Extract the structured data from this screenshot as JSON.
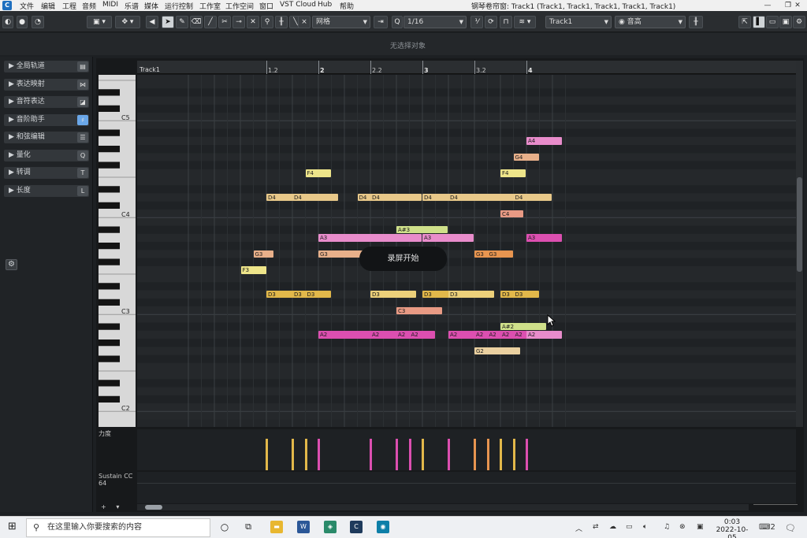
{
  "window": {
    "title": "钢琴卷帘窗: Track1 (Track1, Track1, Track1, Track1, Track1)",
    "buttons": [
      "—",
      "❐",
      "✕"
    ]
  },
  "menu": [
    "文件",
    "编辑",
    "工程",
    "音频",
    "MIDI",
    "乐谱",
    "媒体",
    "运行控制",
    "工作室",
    "工作空间",
    "窗口",
    "VST Cloud",
    "Hub",
    "帮助"
  ],
  "toolbar": {
    "snap_type": "网格",
    "quantize": "1/16",
    "track": "Track1",
    "articulation": "音高"
  },
  "info": {
    "text": "无选择对象"
  },
  "inspector": {
    "sections": [
      {
        "label": "全局轨道",
        "icon": "global-tracks-icon"
      },
      {
        "label": "表达映射",
        "icon": "expression-map-icon"
      },
      {
        "label": "音符表达",
        "icon": "note-expression-icon"
      },
      {
        "label": "音阶助手",
        "icon": "scale-assistant-icon"
      },
      {
        "label": "和弦编辑",
        "icon": "chord-editing-icon"
      },
      {
        "label": "量化",
        "icon": "quantize-icon"
      },
      {
        "label": "转调",
        "icon": "transpose-icon"
      },
      {
        "label": "长度",
        "icon": "length-icon"
      }
    ]
  },
  "ruler": {
    "track_label": "Track1",
    "labels": [
      {
        "t": "1.2",
        "beat": 1,
        "bold": false
      },
      {
        "t": "2",
        "beat": 2,
        "bold": true
      },
      {
        "t": "2.2",
        "beat": 3,
        "bold": false
      },
      {
        "t": "3",
        "beat": 4,
        "bold": true
      },
      {
        "t": "3.2",
        "beat": 5,
        "bold": false
      },
      {
        "t": "4",
        "beat": 6,
        "bold": true
      }
    ]
  },
  "keys": {
    "octave_labels": [
      "C5",
      "C4",
      "C3",
      "C2"
    ]
  },
  "colors": {
    "yellow": "#e2b84a",
    "yellow_light": "#ecd07a",
    "pink": "#dc4fb0",
    "pink_light": "#e88ccb",
    "salmon": "#e89a84",
    "lime": "#cfe08a",
    "orange": "#e89550",
    "cream": "#ead7a0"
  },
  "notes": [
    {
      "p": "F3",
      "s": 1.02,
      "l": 0.5,
      "c": "#eee58a"
    },
    {
      "p": "G3",
      "s": 1.5,
      "l": 0.4,
      "c": "#e8b08a"
    },
    {
      "p": "D4",
      "s": 2.0,
      "l": 1.0,
      "c": "#e8c889"
    },
    {
      "p": "D4",
      "s": 3.0,
      "l": 0.9,
      "c": "#e8c889"
    },
    {
      "p": "D3",
      "s": 2.0,
      "l": 1.0,
      "c": "#e2b84a"
    },
    {
      "p": "D3",
      "s": 3.0,
      "l": 0.5,
      "c": "#e2b84a"
    },
    {
      "p": "D3",
      "s": 3.5,
      "l": 0.5,
      "c": "#e2b84a"
    },
    {
      "p": "F4",
      "s": 3.5,
      "l": 0.5,
      "c": "#eee58a"
    },
    {
      "p": "A3",
      "s": 4.0,
      "l": 2.0,
      "c": "#e88ccb"
    },
    {
      "p": "G3",
      "s": 4.0,
      "l": 1.0,
      "c": "#e8b08a"
    },
    {
      "p": "A2",
      "s": 4.0,
      "l": 2.0,
      "c": "#dc4fb0"
    },
    {
      "p": "D4",
      "s": 5.5,
      "l": 0.5,
      "c": "#e8c889"
    },
    {
      "p": "D4",
      "s": 6.0,
      "l": 1.0,
      "c": "#e8c889"
    },
    {
      "p": "D3",
      "s": 6.0,
      "l": 0.9,
      "c": "#ecd07a"
    },
    {
      "p": "A2",
      "s": 6.0,
      "l": 1.0,
      "c": "#dc4fb0"
    },
    {
      "p": "A#3",
      "s": 7.0,
      "l": 1.0,
      "c": "#cfe08a"
    },
    {
      "p": "G3",
      "s": 7.0,
      "l": 0.9,
      "c": "#e8b08a"
    },
    {
      "p": "C3",
      "s": 7.0,
      "l": 0.9,
      "c": "#e89a84"
    },
    {
      "p": "A2",
      "s": 7.0,
      "l": 0.5,
      "c": "#dc4fb0"
    },
    {
      "p": "A2",
      "s": 7.5,
      "l": 0.5,
      "c": "#dc4fb0"
    },
    {
      "p": "D4",
      "s": 8.0,
      "l": 0.9,
      "c": "#e8c889"
    },
    {
      "p": "A3",
      "s": 8.0,
      "l": 1.0,
      "c": "#e88ccb"
    },
    {
      "p": "D3",
      "s": 8.0,
      "l": 1.0,
      "c": "#e2b84a"
    },
    {
      "p": "D4",
      "s": 9.0,
      "l": 2.0,
      "c": "#e8c889"
    },
    {
      "p": "D3",
      "s": 9.0,
      "l": 0.9,
      "c": "#ecd07a"
    },
    {
      "p": "A2",
      "s": 9.0,
      "l": 1.0,
      "c": "#dc4fb0"
    },
    {
      "p": "G3",
      "s": 10.0,
      "l": 0.5,
      "c": "#e89550"
    },
    {
      "p": "G3",
      "s": 10.5,
      "l": 0.5,
      "c": "#e89550"
    },
    {
      "p": "G2",
      "s": 10.0,
      "l": 0.9,
      "c": "#ead0a0"
    },
    {
      "p": "A2",
      "s": 10.0,
      "l": 0.5,
      "c": "#dc4fb0"
    },
    {
      "p": "A2",
      "s": 10.5,
      "l": 0.5,
      "c": "#dc4fb0"
    },
    {
      "p": "F4",
      "s": 11.0,
      "l": 0.5,
      "c": "#eee58a"
    },
    {
      "p": "C4",
      "s": 11.0,
      "l": 0.45,
      "c": "#e89a84"
    },
    {
      "p": "D3",
      "s": 11.0,
      "l": 0.5,
      "c": "#e2b84a"
    },
    {
      "p": "A#2",
      "s": 11.0,
      "l": 0.9,
      "c": "#cfe08a"
    },
    {
      "p": "A2",
      "s": 11.0,
      "l": 0.5,
      "c": "#dc4fb0"
    },
    {
      "p": "G4",
      "s": 11.5,
      "l": 0.5,
      "c": "#e8b08a"
    },
    {
      "p": "D4",
      "s": 11.5,
      "l": 0.5,
      "c": "#e8c889"
    },
    {
      "p": "D3",
      "s": 11.5,
      "l": 0.5,
      "c": "#e2b84a"
    },
    {
      "p": "A2",
      "s": 11.5,
      "l": 0.5,
      "c": "#dc4fb0"
    },
    {
      "p": "A4",
      "s": 12.0,
      "l": 0.7,
      "c": "#e88ccb"
    },
    {
      "p": "A3",
      "s": 12.0,
      "l": 0.7,
      "c": "#dc4fb0"
    },
    {
      "p": "A2",
      "s": 12.0,
      "l": 0.7,
      "c": "#e88ccb"
    }
  ],
  "lanes": {
    "velocity_label": "力度",
    "sustain_label": "Sustain CC 64"
  },
  "velocity": [
    {
      "s": 2.0,
      "c": "#e2b84a"
    },
    {
      "s": 3.0,
      "c": "#e2b84a"
    },
    {
      "s": 3.5,
      "c": "#e2b84a"
    },
    {
      "s": 4.0,
      "c": "#dc4fb0"
    },
    {
      "s": 6.0,
      "c": "#dc4fb0"
    },
    {
      "s": 7.0,
      "c": "#dc4fb0"
    },
    {
      "s": 7.5,
      "c": "#dc4fb0"
    },
    {
      "s": 8.0,
      "c": "#e2b84a"
    },
    {
      "s": 9.0,
      "c": "#dc4fb0"
    },
    {
      "s": 10.0,
      "c": "#e89550"
    },
    {
      "s": 10.5,
      "c": "#e89550"
    },
    {
      "s": 11.0,
      "c": "#e2b84a"
    },
    {
      "s": 11.5,
      "c": "#e2b84a"
    },
    {
      "s": 12.0,
      "c": "#dc4fb0"
    }
  ],
  "toast": "录屏开始",
  "taskbar": {
    "search_placeholder": "在这里输入你要搜索的内容",
    "time": "0:03",
    "date": "2022-10-05",
    "notif_count": "2"
  }
}
